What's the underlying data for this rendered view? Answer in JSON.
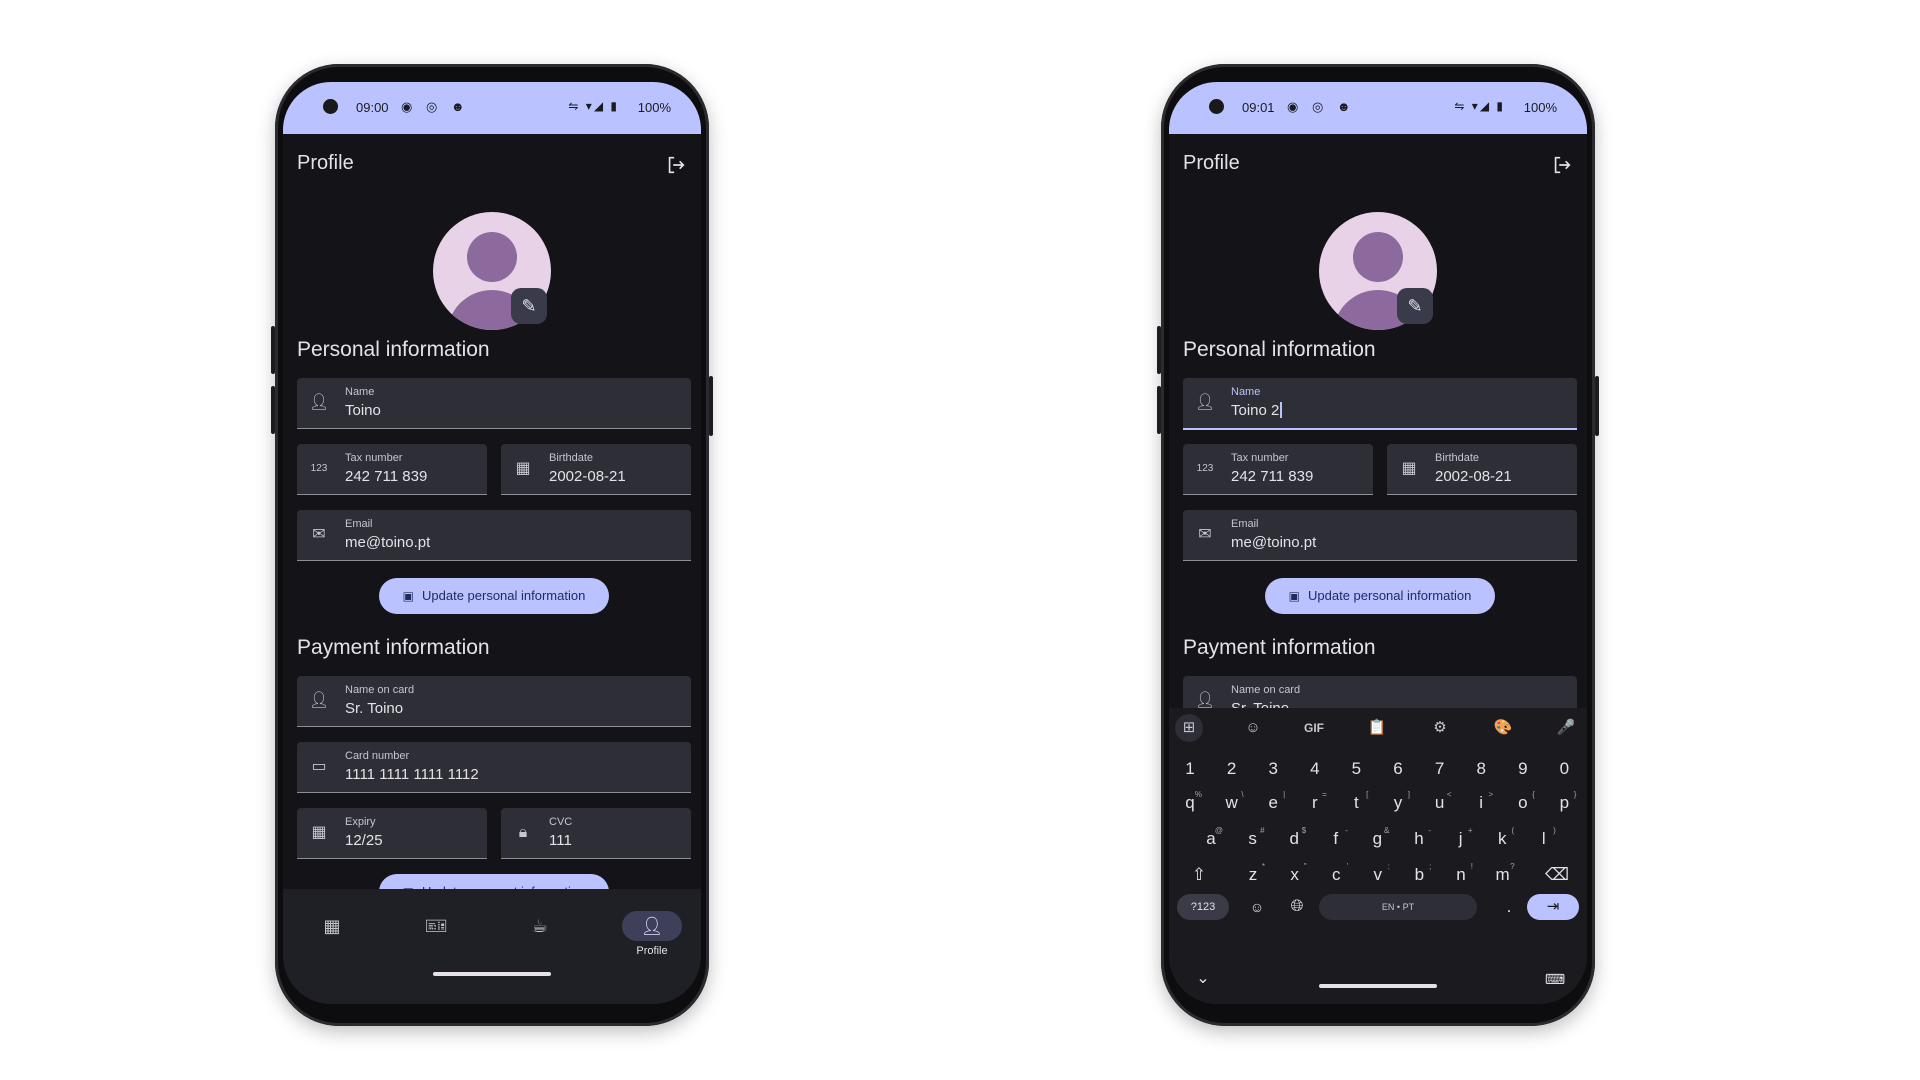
{
  "left": {
    "status": {
      "time": "09:00",
      "app_icons": "◉ ◎ ☻",
      "sys_icons": "⇋ ▾◢ ▮",
      "battery": "100%"
    },
    "appbar": {
      "title": "Profile"
    },
    "sections": {
      "personal": "Personal information",
      "payment": "Payment information"
    },
    "fields": {
      "name": {
        "label": "Name",
        "value": "Toino"
      },
      "tax": {
        "label": "Tax number",
        "value": "242 711 839"
      },
      "birthdate": {
        "label": "Birthdate",
        "value": "2002-08-21"
      },
      "email": {
        "label": "Email",
        "value": "me@toino.pt"
      },
      "card_name": {
        "label": "Name on card",
        "value": "Sr. Toino"
      },
      "card_number": {
        "label": "Card number",
        "value": "1111 1111 1111 1112"
      },
      "expiry": {
        "label": "Expiry",
        "value": "12/25"
      },
      "cvc": {
        "label": "CVC",
        "value": "111"
      }
    },
    "buttons": {
      "update_personal": "Update personal information",
      "update_payment": "Update payment information"
    },
    "nav": {
      "profile_label": "Profile"
    }
  },
  "right": {
    "status": {
      "time": "09:01",
      "app_icons": "◉ ◎ ☻",
      "sys_icons": "⇋ ▾◢ ▮",
      "battery": "100%"
    },
    "appbar": {
      "title": "Profile"
    },
    "sections": {
      "personal": "Personal information",
      "payment": "Payment information"
    },
    "fields": {
      "name": {
        "label": "Name",
        "value": "Toino 2"
      },
      "tax": {
        "label": "Tax number",
        "value": "242 711 839"
      },
      "birthdate": {
        "label": "Birthdate",
        "value": "2002-08-21"
      },
      "email": {
        "label": "Email",
        "value": "me@toino.pt"
      },
      "card_name": {
        "label": "Name on card",
        "value": "Sr. Toino"
      }
    },
    "buttons": {
      "update_personal": "Update personal information"
    },
    "keyboard": {
      "toolbar": [
        "⊞",
        "☺",
        "GIF",
        "📋",
        "⚙",
        "🎨",
        "🎤"
      ],
      "numbers": [
        "1",
        "2",
        "3",
        "4",
        "5",
        "6",
        "7",
        "8",
        "9",
        "0"
      ],
      "row1": [
        "q",
        "w",
        "e",
        "r",
        "t",
        "y",
        "u",
        "i",
        "o",
        "p"
      ],
      "row1_alt": [
        "%",
        "\\",
        "|",
        "=",
        "[",
        "]",
        "<",
        ">",
        "{",
        "}"
      ],
      "row2": [
        "a",
        "s",
        "d",
        "f",
        "g",
        "h",
        "j",
        "k",
        "l"
      ],
      "row2_alt": [
        "@",
        "#",
        "$",
        "-",
        "&",
        "-",
        "+",
        "(",
        ")"
      ],
      "row3": [
        "z",
        "x",
        "c",
        "v",
        "b",
        "n",
        "m"
      ],
      "row3_alt": [
        "*",
        "\"",
        "'",
        ":",
        ";",
        "!",
        "?"
      ],
      "symbols_key": "?123",
      "lang": "EN • PT",
      "period": ".",
      "collapse": "⌄",
      "kb_switch": "⌨"
    }
  },
  "colors": {
    "accent": "#bac3ff",
    "surface": "#131318",
    "field": "#2d2e36",
    "on_surface": "#e4e1e9"
  }
}
